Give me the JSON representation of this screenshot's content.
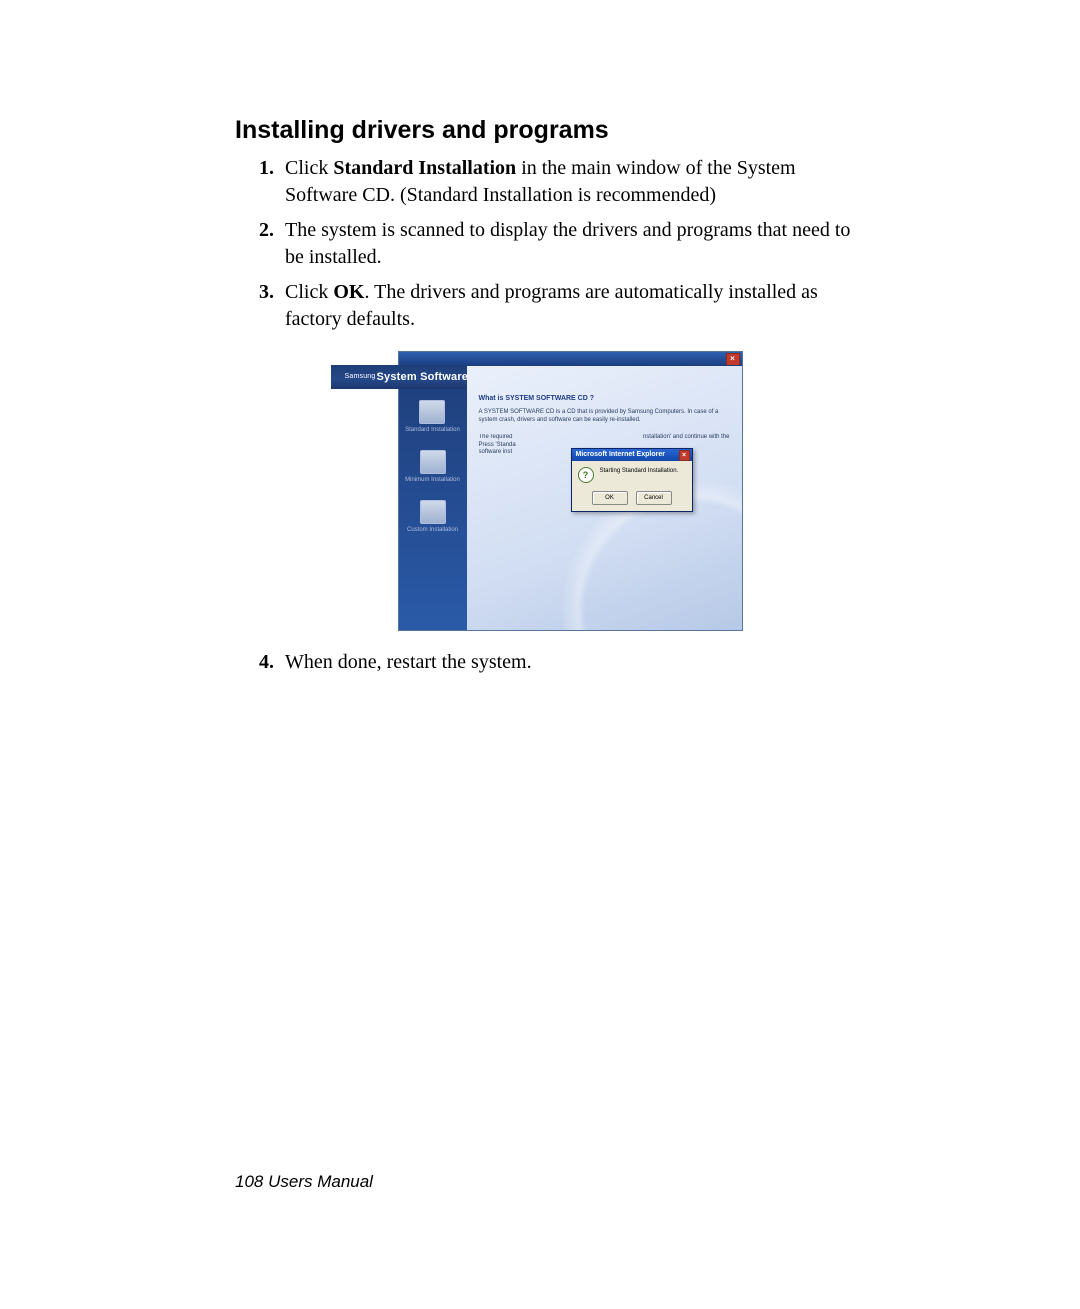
{
  "heading": "Installing drivers and programs",
  "steps": {
    "s1a": "Click ",
    "s1b": "Standard Installation",
    "s1c": " in the main window of the System Software CD. (Standard Installation is recommended)",
    "s2": "The system is scanned to display the drivers and programs that need to be installed.",
    "s3a": "Click ",
    "s3b": "OK",
    "s3c": ". The drivers and programs are automatically installed as factory defaults.",
    "s4": "When done, restart the system."
  },
  "app": {
    "brand_small": "Samsung",
    "brand_title": "System Software CD",
    "close_label": "×",
    "sidebar": {
      "standard": "Standard Installation",
      "minimum": "Minimum Installation",
      "custom": "Custom Installation"
    },
    "pane": {
      "head": "What is SYSTEM SOFTWARE CD ?",
      "desc": "A SYSTEM SOFTWARE CD is a CD that is provided by Samsung Computers. In case of a system crash, drivers and software can be easily re-installed.",
      "sub_left": "The required Press 'Standa software inst",
      "sub_right": "nstallation' and continue with the"
    },
    "dialog": {
      "title": "Microsoft Internet Explorer",
      "close": "×",
      "question_icon": "?",
      "message": "Starting Standard Installation.",
      "ok": "OK",
      "cancel": "Cancel"
    }
  },
  "footer": "108  Users Manual"
}
